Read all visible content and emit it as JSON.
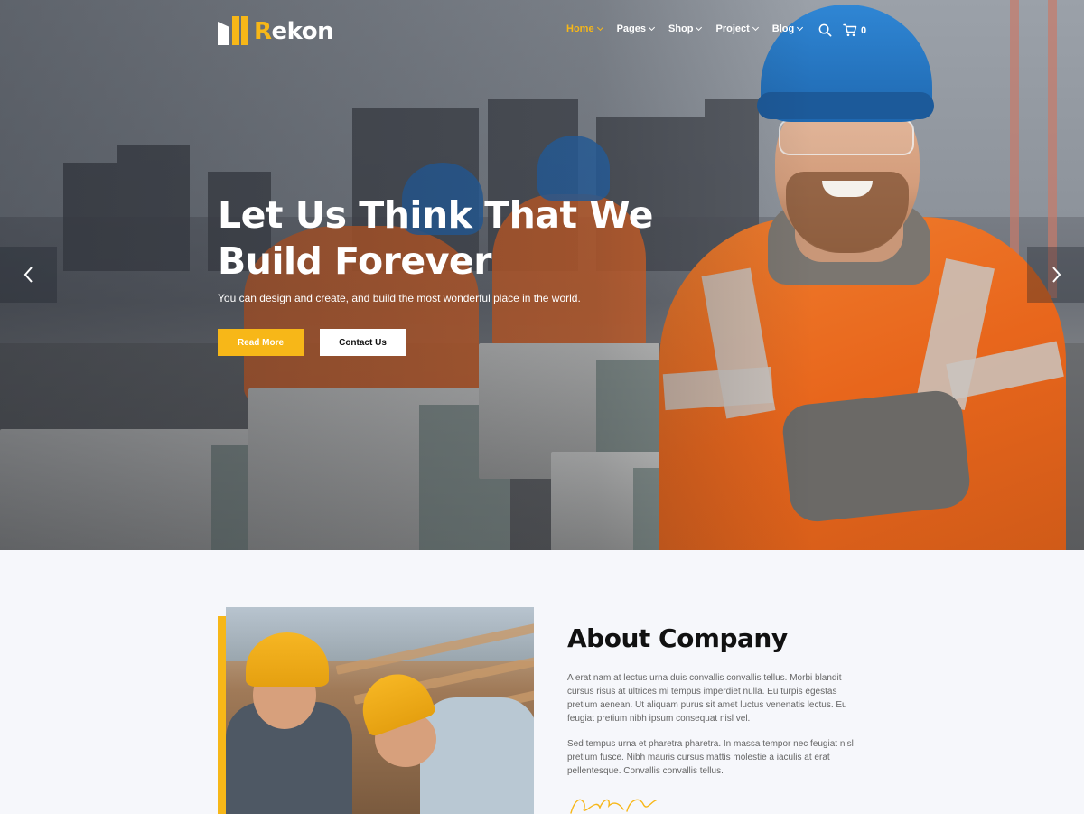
{
  "brand": {
    "name_prefix": "R",
    "name_rest": "ekon",
    "accent_color": "#f7b718"
  },
  "nav": {
    "items": [
      {
        "label": "Home",
        "active": true
      },
      {
        "label": "Pages",
        "active": false
      },
      {
        "label": "Shop",
        "active": false
      },
      {
        "label": "Project",
        "active": false
      },
      {
        "label": "Blog",
        "active": false
      }
    ],
    "cart_count": "0",
    "icons": [
      "search-icon",
      "cart-icon"
    ]
  },
  "hero": {
    "title": "Let Us Think That We Build Forever",
    "subtitle": "You can design and create, and build the most wonderful place in the world.",
    "primary_button": "Read More",
    "secondary_button": "Contact Us",
    "slider_icons": [
      "chevron-left-icon",
      "chevron-right-icon"
    ]
  },
  "about": {
    "title": "About Company",
    "paragraph1": "A erat nam at lectus urna duis convallis convallis tellus. Morbi blandit cursus risus at ultrices mi tempus imperdiet nulla. Eu turpis egestas pretium aenean. Ut aliquam purus sit amet luctus venenatis lectus. Eu feugiat pretium nibh ipsum consequat nisl vel.",
    "paragraph2": "Sed tempus urna et pharetra pharetra. In massa tempor nec feugiat nisl pretium fusce. Nibh mauris cursus mattis molestie a iaculis at erat pellentesque. Convallis convallis tellus."
  }
}
